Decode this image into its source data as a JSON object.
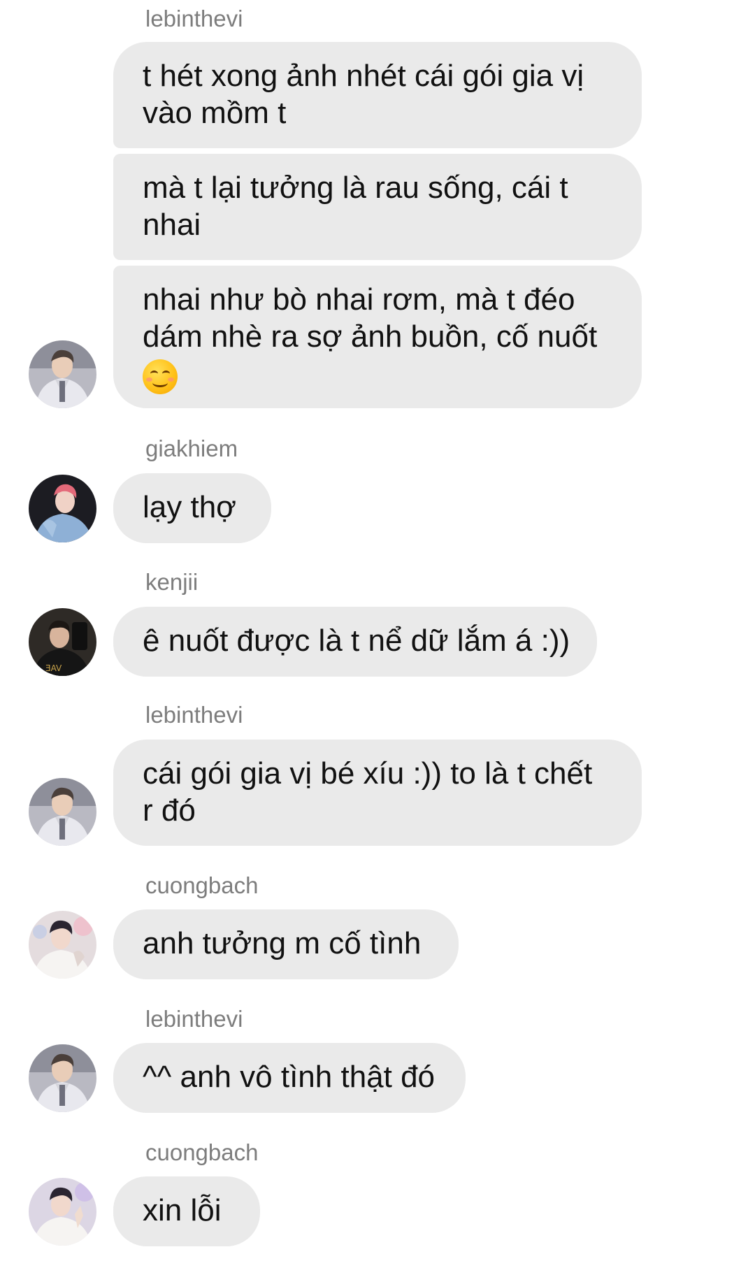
{
  "messages": [
    {
      "sender": "lebinthevi",
      "bubbles": [
        [
          "t hét xong ảnh nhét cái gói gia vị",
          "vào mồm t"
        ],
        [
          "mà t lại tưởng là rau sống, cái t",
          "nhai"
        ],
        [
          "nhai như bò nhai rơm, mà t đéo",
          "dám nhè ra sợ ảnh buồn, cố nuốt"
        ]
      ],
      "emoji": "smiling-face-icon"
    },
    {
      "sender": "giakhiem",
      "bubbles": [
        [
          "lạy thợ"
        ]
      ]
    },
    {
      "sender": "kenjii",
      "bubbles": [
        [
          "ê nuốt được là t nể dữ lắm á :))"
        ]
      ]
    },
    {
      "sender": "lebinthevi",
      "bubbles": [
        [
          "cái gói gia vị bé xíu :)) to là t chết",
          "r đó"
        ]
      ]
    },
    {
      "sender": "cuongbach",
      "bubbles": [
        [
          "anh tưởng m cố tình"
        ]
      ]
    },
    {
      "sender": "lebinthevi",
      "bubbles": [
        [
          "^^ anh vô tình thật đó"
        ]
      ]
    },
    {
      "sender": "cuongbach",
      "bubbles": [
        [
          "xin lỗi"
        ]
      ]
    }
  ],
  "colors": {
    "bubble": "#eaeaea",
    "sender_text": "#7d7d7d",
    "message_text": "#111111"
  }
}
